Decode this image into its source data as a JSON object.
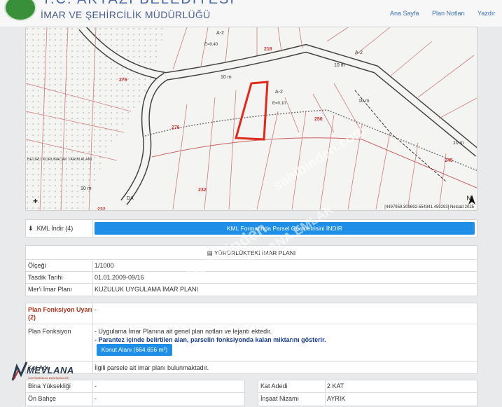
{
  "header": {
    "top_title": "T.C. AKYAZI BELEDİYESİ",
    "title": "İMAR VE ŞEHİRCİLİK MÜDÜRLÜĞÜ",
    "nav": [
      "Ana Sayfa",
      "Plan Notları",
      "Yazdır"
    ]
  },
  "map": {
    "coord_readout": "[4497959.309692-554341.459293] Netcad 2025",
    "north_label": "N",
    "plus_label": "+",
    "labels": [
      "A-2",
      "E=0.40",
      "218",
      "A-2",
      "10 m",
      "276",
      "10 m",
      "A-2",
      "E=0.10",
      "250",
      "10 m",
      "10 m",
      "245",
      "276",
      "BELİRLİ KORUNACAK TARIM ALANI",
      "232",
      "10 m",
      "DA",
      "232"
    ],
    "parcel_color": "#e02a1c"
  },
  "kml": {
    "label": ".KML İndir",
    "note": "(4)",
    "button": "KML Formatında Parsel Geometrisini İNDİR"
  },
  "plan": {
    "section_title": "YÜRÜRLÜKTEKİ İMAR PLANI",
    "rows": [
      {
        "label": "Ölçeği",
        "value": "1/1000"
      },
      {
        "label": "Tasdik Tarihi",
        "value": "01.01.2009-09/16"
      },
      {
        "label": "Mer'i İmar Planı",
        "value": "KUZULUK UYGULAMA İMAR PLANI"
      }
    ]
  },
  "function": {
    "uyari_label": "Plan Fonksiyon Uyarı",
    "uyari_note": "(2)",
    "uyari_value": "-",
    "label": "Plan Fonksiyon",
    "line1": "- Uygulama İmar Planına ait genel plan notları ve lejantı ektedir.",
    "line2": "- Parantez içinde belirtilen alan, parselin fonksiyonda kalan miktarını gösterir.",
    "konut_button": "Konut Alanı (664.656 m²)",
    "kot_label": "Kot Adı",
    "kot_value": "İlgili parsele ait imar planı bulunmaktadır."
  },
  "details": {
    "left": [
      {
        "label": "Bina Yüksekliği",
        "value": "-"
      },
      {
        "label": "Ön Bahçe",
        "value": "-"
      }
    ],
    "right": [
      {
        "label": "Kat Adedi",
        "value": "2 KAT"
      },
      {
        "label": "İnşaat Nizamı",
        "value": "AYRIK"
      }
    ]
  },
  "branding": {
    "logo_text": "MEVLANA",
    "logo_subtitle": "GAYRİMENKUL DANIŞMANLIĞI",
    "watermarks": [
      "Sahibinden",
      "MEVLANA EMLAK",
      "sahibinden.com"
    ]
  },
  "colors": {
    "accent": "#1e8ee6",
    "warning_label": "#b0341f",
    "nav": "#3f72b5"
  }
}
